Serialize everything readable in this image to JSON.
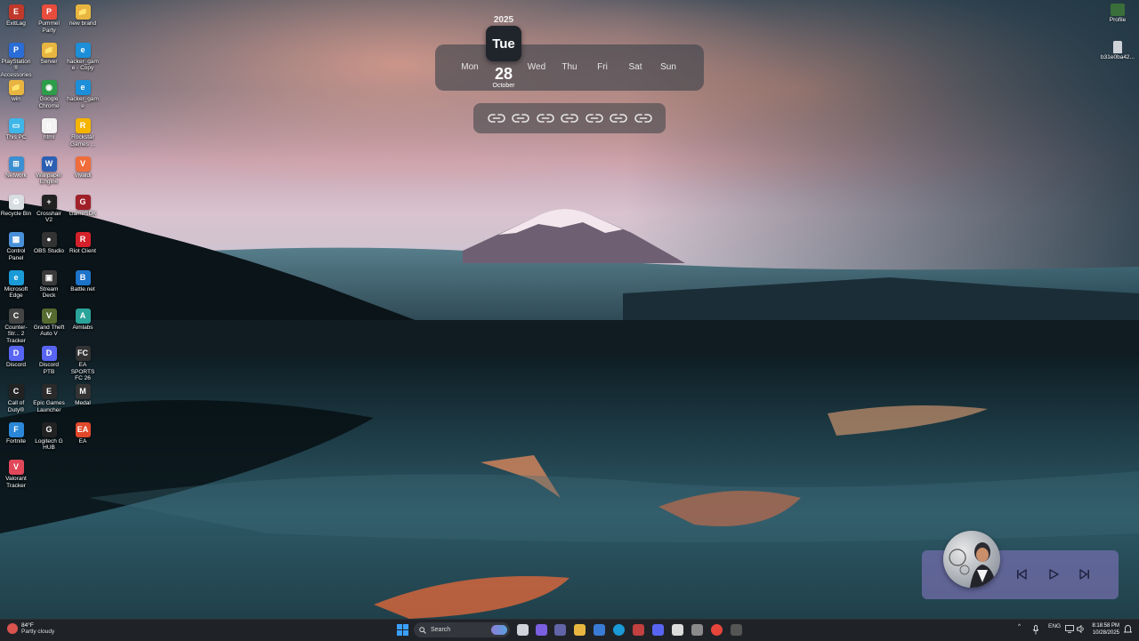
{
  "desktop": {
    "icons": [
      {
        "label": "ExitLag",
        "color": "#c0392b",
        "glyph": "E"
      },
      {
        "label": "Pummel Party",
        "color": "#e74c3c",
        "glyph": "P"
      },
      {
        "label": "new brand",
        "color": "#e8b640",
        "glyph": "📁"
      },
      {
        "label": "PlayStation® Accessories",
        "color": "#2a6dd6",
        "glyph": "P"
      },
      {
        "label": "Server",
        "color": "#e8b640",
        "glyph": "📁"
      },
      {
        "label": "hacker_game - Copy",
        "color": "#1c8fd8",
        "glyph": "e"
      },
      {
        "label": "win",
        "color": "#e8b640",
        "glyph": "📁"
      },
      {
        "label": "Google Chrome",
        "color": "#2e9d4a",
        "glyph": "◉"
      },
      {
        "label": "hacker_game",
        "color": "#1c8fd8",
        "glyph": "e"
      },
      {
        "label": "This PC",
        "color": "#3fb6e8",
        "glyph": "▭"
      },
      {
        "label": "html",
        "color": "#f2f2f2",
        "glyph": "▯"
      },
      {
        "label": "Rockstar Games ...",
        "color": "#f4b400",
        "glyph": "R"
      },
      {
        "label": "Network",
        "color": "#3c8fd0",
        "glyph": "⊞"
      },
      {
        "label": "Wallpaper Engine",
        "color": "#2b5fb3",
        "glyph": "W"
      },
      {
        "label": "Vivaldi",
        "color": "#ef6d3a",
        "glyph": "V"
      },
      {
        "label": "Recycle Bin",
        "color": "#d8dde2",
        "glyph": "♻"
      },
      {
        "label": "Crosshair V2",
        "color": "#222",
        "glyph": "+"
      },
      {
        "label": "GameSDK",
        "color": "#a0202a",
        "glyph": "G"
      },
      {
        "label": "Control Panel",
        "color": "#4a90d9",
        "glyph": "▦"
      },
      {
        "label": "OBS Studio",
        "color": "#333",
        "glyph": "●"
      },
      {
        "label": "Riot Client",
        "color": "#d4202a",
        "glyph": "R"
      },
      {
        "label": "Microsoft Edge",
        "color": "#1a9ad6",
        "glyph": "e"
      },
      {
        "label": "Stream Deck",
        "color": "#3a3a3a",
        "glyph": "▣"
      },
      {
        "label": "Battle.net",
        "color": "#1d73c9",
        "glyph": "B"
      },
      {
        "label": "Counter-Str... 2 Tracker",
        "color": "#444",
        "glyph": "C"
      },
      {
        "label": "Grand Theft Auto V",
        "color": "#556b2f",
        "glyph": "V"
      },
      {
        "label": "Aimlabs",
        "color": "#2aa39a",
        "glyph": "A"
      },
      {
        "label": "Discord",
        "color": "#5865f2",
        "glyph": "D"
      },
      {
        "label": "Discord PTB",
        "color": "#5865f2",
        "glyph": "D"
      },
      {
        "label": "EA SPORTS FC 26",
        "color": "#333",
        "glyph": "FC"
      },
      {
        "label": "Call of Duty®",
        "color": "#222",
        "glyph": "C"
      },
      {
        "label": "Epic Games Launcher",
        "color": "#2a2a2a",
        "glyph": "E"
      },
      {
        "label": "Medal",
        "color": "#333",
        "glyph": "M"
      },
      {
        "label": "Fortnite",
        "color": "#2b87d8",
        "glyph": "F"
      },
      {
        "label": "Logitech G HUB",
        "color": "#222",
        "glyph": "G"
      },
      {
        "label": "EA",
        "color": "#e0482a",
        "glyph": "EA"
      },
      {
        "label": "Valorant Tracker",
        "color": "#e0485a",
        "glyph": "V"
      }
    ],
    "top_right": [
      {
        "label": "Profile",
        "color": "#3a6f3a",
        "glyph": "▤"
      },
      {
        "label": "b31e0ba42...",
        "color": "#cfd3d8",
        "glyph": "♟"
      }
    ]
  },
  "calendar": {
    "year": "2025",
    "days": [
      "Mon",
      "Tue",
      "Wed",
      "Thu",
      "Fri",
      "Sat",
      "Sun"
    ],
    "active_day": "Tue",
    "date": "28",
    "month": "October"
  },
  "links": {
    "count": 7,
    "icon": "link-icon"
  },
  "media": {
    "prev": "skip-previous-icon",
    "play": "play-icon",
    "next": "skip-next-icon"
  },
  "taskbar": {
    "weather": {
      "temp": "84°F",
      "condition": "Partly cloudy"
    },
    "search_placeholder": "Search",
    "apps": [
      {
        "name": "task-view",
        "color": "#d0d4da"
      },
      {
        "name": "copilot",
        "color": "#7a5fe0"
      },
      {
        "name": "teams",
        "color": "#6264a7"
      },
      {
        "name": "file-explorer",
        "color": "#e8b640"
      },
      {
        "name": "store",
        "color": "#3a7bd5"
      },
      {
        "name": "edge",
        "color": "#1a9ad6"
      },
      {
        "name": "settings",
        "color": "#c24040"
      },
      {
        "name": "discord",
        "color": "#5865f2"
      },
      {
        "name": "epic",
        "color": "#dcdcdc"
      },
      {
        "name": "xbox",
        "color": "#8a8a8a"
      },
      {
        "name": "chrome",
        "color": "#e7453b"
      },
      {
        "name": "terminal",
        "color": "#555"
      }
    ],
    "lang": "ENG",
    "time": "8:18:58 PM",
    "date": "10/28/2025"
  }
}
